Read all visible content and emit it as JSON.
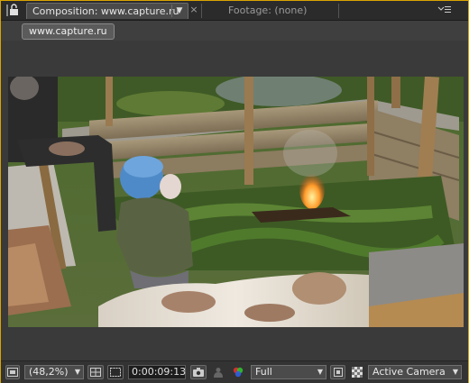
{
  "tabs": {
    "composition_label": "Composition: www.capture.ru",
    "composition_dropdown_icon": "chevron-down-icon",
    "close_glyph": "×",
    "footage_label": "Footage: (none)"
  },
  "breadcrumb": {
    "label": "www.capture.ru"
  },
  "toolbar": {
    "magnification": "(48,2%)",
    "timecode": "0:00:09:13",
    "resolution": "Full",
    "view": "Active Camera"
  },
  "colors": {
    "panel_focus_border": "#d9a400",
    "panel_bg": "#3f3f3f",
    "tab_bg": "#2b2b2b"
  }
}
